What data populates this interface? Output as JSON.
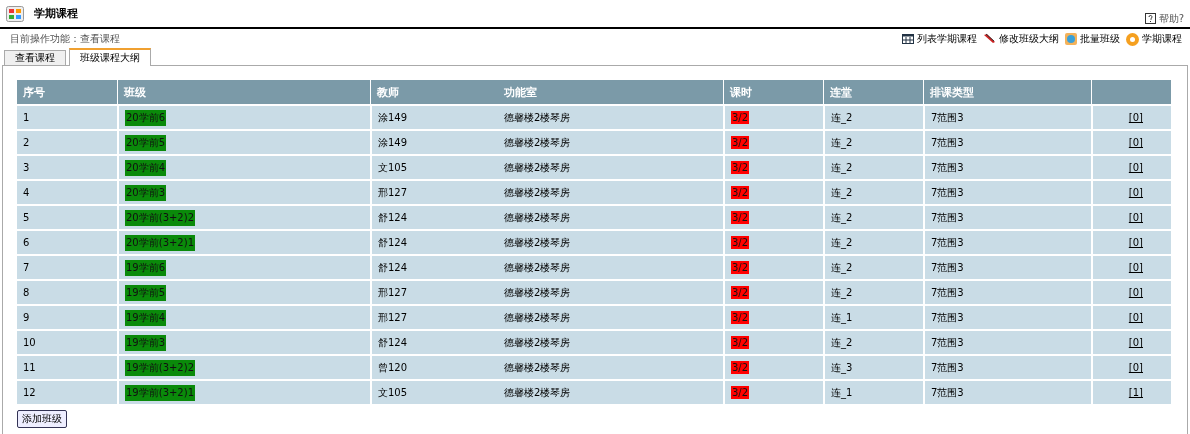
{
  "header": {
    "title": "学期课程",
    "help": "帮助?"
  },
  "breadcrumb": "目前操作功能：查看课程",
  "actions": [
    {
      "kind": "table",
      "label": "列表学期课程"
    },
    {
      "kind": "pen",
      "label": "修改班级大纲"
    },
    {
      "kind": "globe",
      "label": "批量班级"
    },
    {
      "kind": "circle",
      "label": "学期课程"
    }
  ],
  "tabs": [
    {
      "label": "查看课程",
      "selected": false
    },
    {
      "label": "班级课程大纲",
      "selected": true
    }
  ],
  "table": {
    "columns": [
      "序号",
      "班级",
      "教师",
      "功能室",
      "课时",
      "连堂",
      "排课类型"
    ],
    "rows": [
      {
        "no": "1",
        "class": "20学前6",
        "teacher": "涂149",
        "room": "德馨楼2楼琴房",
        "hours": "3/2",
        "consecutive": "连_2",
        "type": "7范围3",
        "link": "[0]"
      },
      {
        "no": "2",
        "class": "20学前5",
        "teacher": "涂149",
        "room": "德馨楼2楼琴房",
        "hours": "3/2",
        "consecutive": "连_2",
        "type": "7范围3",
        "link": "[0]"
      },
      {
        "no": "3",
        "class": "20学前4",
        "teacher": "文105",
        "room": "德馨楼2楼琴房",
        "hours": "3/2",
        "consecutive": "连_2",
        "type": "7范围3",
        "link": "[0]"
      },
      {
        "no": "4",
        "class": "20学前3",
        "teacher": "邢127",
        "room": "德馨楼2楼琴房",
        "hours": "3/2",
        "consecutive": "连_2",
        "type": "7范围3",
        "link": "[0]"
      },
      {
        "no": "5",
        "class": "20学前(3+2)2",
        "teacher": "舒124",
        "room": "德馨楼2楼琴房",
        "hours": "3/2",
        "consecutive": "连_2",
        "type": "7范围3",
        "link": "[0]"
      },
      {
        "no": "6",
        "class": "20学前(3+2)1",
        "teacher": "舒124",
        "room": "德馨楼2楼琴房",
        "hours": "3/2",
        "consecutive": "连_2",
        "type": "7范围3",
        "link": "[0]"
      },
      {
        "no": "7",
        "class": "19学前6",
        "teacher": "舒124",
        "room": "德馨楼2楼琴房",
        "hours": "3/2",
        "consecutive": "连_2",
        "type": "7范围3",
        "link": "[0]"
      },
      {
        "no": "8",
        "class": "19学前5",
        "teacher": "邢127",
        "room": "德馨楼2楼琴房",
        "hours": "3/2",
        "consecutive": "连_2",
        "type": "7范围3",
        "link": "[0]"
      },
      {
        "no": "9",
        "class": "19学前4",
        "teacher": "邢127",
        "room": "德馨楼2楼琴房",
        "hours": "3/2",
        "consecutive": "连_1",
        "type": "7范围3",
        "link": "[0]"
      },
      {
        "no": "10",
        "class": "19学前3",
        "teacher": "舒124",
        "room": "德馨楼2楼琴房",
        "hours": "3/2",
        "consecutive": "连_2",
        "type": "7范围3",
        "link": "[0]"
      },
      {
        "no": "11",
        "class": "19学前(3+2)2",
        "teacher": "曾120",
        "room": "德馨楼2楼琴房",
        "hours": "3/2",
        "consecutive": "连_3",
        "type": "7范围3",
        "link": "[0]"
      },
      {
        "no": "12",
        "class": "19学前(3+2)1",
        "teacher": "文105",
        "room": "德馨楼2楼琴房",
        "hours": "3/2",
        "consecutive": "连_1",
        "type": "7范围3",
        "link": "[1]"
      }
    ]
  },
  "add_button": "添加班级"
}
